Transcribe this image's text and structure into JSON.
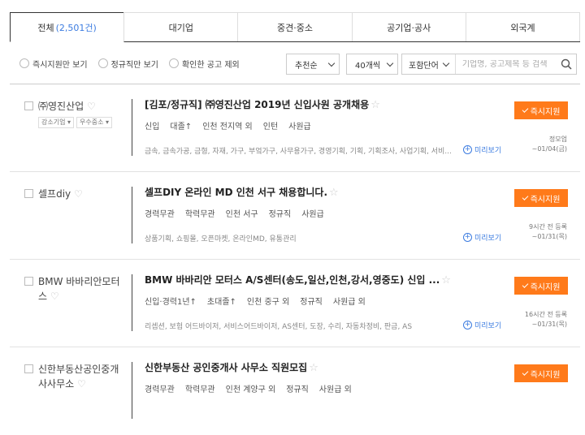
{
  "tabs": [
    {
      "label": "전체",
      "count": "(2,501건)",
      "active": true
    },
    {
      "label": "대기업",
      "count": ""
    },
    {
      "label": "중견·중소",
      "count": ""
    },
    {
      "label": "공기업·공사",
      "count": ""
    },
    {
      "label": "외국계",
      "count": ""
    }
  ],
  "filters": {
    "radio": [
      "즉시지원만 보기",
      "정규직만 보기",
      "확인한 공고 제외"
    ],
    "sort": "추천순",
    "per_page": "40개씩",
    "search_scope": "포함단어",
    "search_placeholder": "기업명, 공고제목 등 검색"
  },
  "jobs": [
    {
      "company": "㈜영진산업",
      "badges": [
        "강소기업",
        "우수중소"
      ],
      "title": "[김포/정규직] ㈜영진산업 2019년 신입사원 공개채용",
      "conditions": [
        "신입",
        "대졸↑",
        "인천 전지역 외",
        "인턴",
        "사원급"
      ],
      "tags": "금속, 금속가공, 금형, 자재, 가구, 부엌가구, 사무용가구, 경영기획, 기획, 기획조사, 사업기획, 서비...",
      "meta1": "정모업",
      "meta2": "~01/04(금)",
      "apply": "즉시지원",
      "more": "미리보기"
    },
    {
      "company": "셀프diy",
      "badges": [],
      "title": "셀프DIY 온라인 MD 인천 서구 채용합니다.",
      "conditions": [
        "경력무관",
        "학력무관",
        "인천 서구",
        "정규직",
        "사원급"
      ],
      "tags": "상품기획, 쇼핑몰, 오픈마켓, 온라인MD, 유통관리",
      "meta1": "9시간 전 등록",
      "meta2": "~01/31(목)",
      "apply": "즉시지원",
      "more": "미리보기"
    },
    {
      "company": "BMW 바바리안모터스",
      "badges": [],
      "title": "BMW 바바리안 모터스 A/S센터(송도,일산,인천,강서,영중도) 신입 ...",
      "conditions": [
        "신입·경력1년↑",
        "초대졸↑",
        "인천 중구 외",
        "정규직",
        "사원급 외"
      ],
      "tags": "리셉션, 보험 어드바이저, 서비스어드바이저, AS센터, 도장, 수리, 자동차정비, 판금, AS",
      "meta1": "16시간 전 등록",
      "meta2": "~01/31(목)",
      "apply": "즉시지원",
      "more": "미리보기"
    },
    {
      "company": "신한부동산공인중개사사무소",
      "badges": [],
      "title": "신한부동산 공인중개사 사무소 직원모집",
      "conditions": [
        "경력무관",
        "학력무관",
        "인천 계양구 외",
        "정규직",
        "사원급 외"
      ],
      "tags": "",
      "meta1": "",
      "meta2": "",
      "apply": "즉시지원",
      "more": ""
    }
  ]
}
